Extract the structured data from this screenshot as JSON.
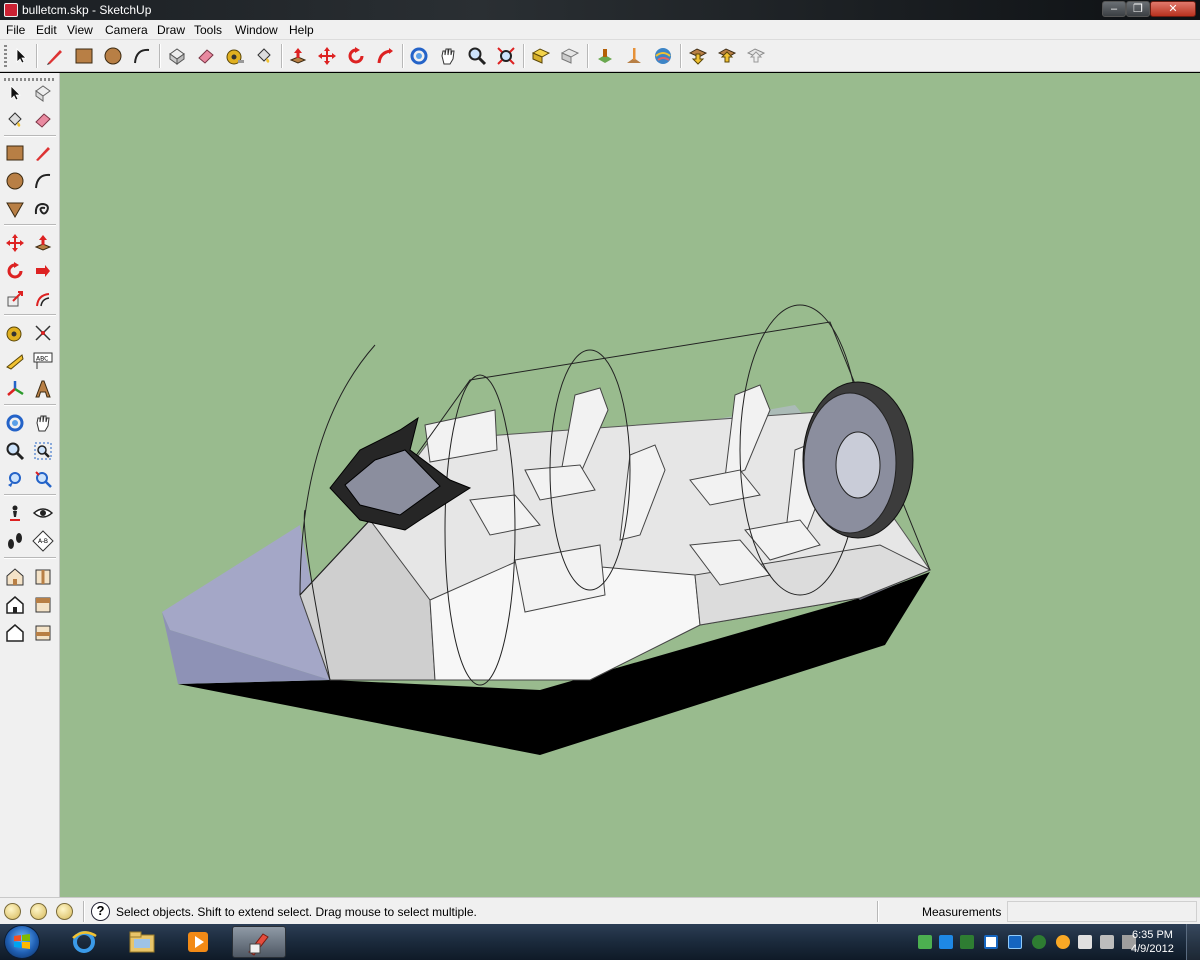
{
  "window": {
    "title": "bulletcm.skp - SketchUp",
    "minimize_glyph": "–",
    "maximize_glyph": "❐",
    "close_glyph": "✕"
  },
  "menu": [
    "File",
    "Edit",
    "View",
    "Camera",
    "Draw",
    "Tools",
    "Window",
    "Help"
  ],
  "toolbar_top": {
    "tools": [
      "select-arrow-icon",
      "pencil-line-icon",
      "rectangle-icon",
      "circle-icon",
      "arc-icon",
      "make-component-icon",
      "eraser-icon",
      "tape-measure-icon",
      "paint-bucket-icon",
      "push-pull-icon",
      "move-icon",
      "rotate-icon",
      "follow-me-icon",
      "orbit-icon",
      "pan-icon",
      "zoom-icon",
      "zoom-extents-icon",
      "previous-view-icon",
      "next-view-icon",
      "get-models-icon",
      "share-model-icon",
      "add-location-icon",
      "google-earth-icon",
      "get-current-view-icon",
      "toggle-terrain-icon",
      "place-model-icon"
    ]
  },
  "toolbar_left": {
    "tools": [
      "select-icon",
      "make-component-icon",
      "paint-bucket-icon",
      "eraser-icon",
      "rectangle-icon",
      "line-icon",
      "circle-icon",
      "arc-icon",
      "polygon-icon",
      "freehand-icon",
      "move-icon",
      "push-pull-icon",
      "rotate-icon",
      "follow-me-icon",
      "scale-icon",
      "offset-icon",
      "tape-measure-icon",
      "dimension-icon",
      "protractor-icon",
      "text-icon",
      "axes-icon",
      "3d-text-icon",
      "orbit-icon",
      "pan-icon",
      "zoom-icon",
      "zoom-window-icon",
      "zoom-extents-icon",
      "previous-view-icon",
      "position-camera-icon",
      "look-around-icon",
      "walk-icon",
      "section-plane-icon",
      "iso-view-icon",
      "top-view-icon",
      "front-view-icon",
      "right-view-icon",
      "back-view-icon",
      "left-view-icon"
    ]
  },
  "status": {
    "hint": "Select objects. Shift to extend select. Drag mouse to select multiple.",
    "measurements_label": "Measurements",
    "measurements_value": ""
  },
  "taskbar": {
    "apps": [
      "internet-explorer-icon",
      "windows-explorer-icon",
      "media-player-icon",
      "sketchup-icon"
    ],
    "active_app": "sketchup-icon",
    "time": "6:35 PM",
    "date": "4/9/2012",
    "tray": [
      "network-sync-icon",
      "shield-icon",
      "bluetooth-icon",
      "s-badge-icon",
      "monitor-icon",
      "star-icon",
      "settings-icon",
      "flag-icon",
      "network-icon",
      "volume-icon"
    ]
  },
  "colors": {
    "viewport_bg": "#99bb8e",
    "hull_side": "#ffffff",
    "hull_bottom": "#000000",
    "glass_tint": "#b9bcd8"
  }
}
